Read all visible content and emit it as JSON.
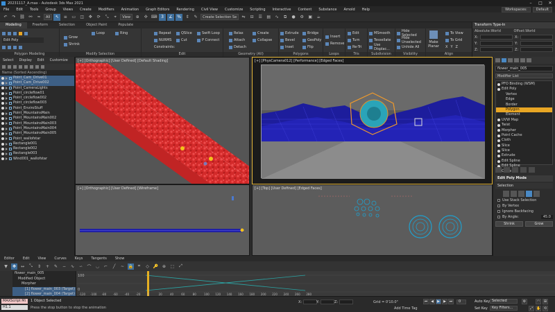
{
  "app": {
    "title": "20231117_A.max - Autodesk 3ds Max 2021"
  },
  "menu": [
    "File",
    "Edit",
    "Tools",
    "Group",
    "Views",
    "Create",
    "Modifiers",
    "Animation",
    "Graph Editors",
    "Rendering",
    "Civil View",
    "Customize",
    "Scripting",
    "Interactive",
    "Content",
    "Substance",
    "Arnold",
    "Help"
  ],
  "workspace": {
    "label": "Workspaces:",
    "value": "Default"
  },
  "toolbar": {
    "filter": "All",
    "view": "View",
    "selection_set": "Create Selection Se",
    "named_set_arrow": "▾"
  },
  "ribbon": {
    "tabs": [
      "Modeling",
      "Freeform",
      "Selection",
      "Object Paint",
      "Populate"
    ],
    "active_tab": "Modeling",
    "edit_poly_label": "Edit Poly",
    "groups": [
      {
        "name": "Polygon Modeling",
        "buttons": []
      },
      {
        "name": "Modify Selection",
        "buttons": [
          "Grow",
          "Shrink",
          "Loop",
          "Ring"
        ]
      },
      {
        "name": "Edit",
        "buttons": [
          "Repeat",
          "QSlice",
          "Swift Loop",
          "NURMS",
          "Cut",
          "P Connect",
          "Constraints:"
        ]
      },
      {
        "name": "Geometry (All)",
        "buttons": [
          "Relax",
          "Create",
          "Attach",
          "Collapse",
          "Detach"
        ]
      },
      {
        "name": "Polygons",
        "buttons": [
          "Extrude",
          "Bridge",
          "Bevel",
          "GeoPoly",
          "Inset",
          "Flip"
        ]
      },
      {
        "name": "Loops",
        "buttons": [
          "Insert",
          "Remove"
        ]
      },
      {
        "name": "Tris",
        "buttons": [
          "Edit",
          "Turn",
          "Re-Tri"
        ]
      },
      {
        "name": "Subdivision",
        "buttons": [
          "MSmooth",
          "Tessellate",
          "Use Displac..."
        ]
      },
      {
        "name": "Visibility",
        "buttons": [
          "Hide Selected",
          "Hide Unselected",
          "Unhide All"
        ]
      },
      {
        "name": "Align",
        "buttons": [
          "Make Planar",
          "To View",
          "To Grid",
          "X",
          "Y",
          "Z"
        ]
      }
    ]
  },
  "type_in": {
    "title": "Transform Type-In",
    "col1": "Absolute:World",
    "col2": "Offset:World",
    "axes": [
      "X:",
      "Y:",
      "Z:"
    ]
  },
  "scene_explorer": {
    "menu": [
      "Select",
      "Display",
      "Edit",
      "Customize"
    ],
    "header": "Name (Sorted Ascending)",
    "rows": [
      {
        "label": "Point_Cam_Drive01",
        "sel": true
      },
      {
        "label": "Point_Cam_Drive002",
        "sel": true
      },
      {
        "label": "Point_CameraLights",
        "sel": false
      },
      {
        "label": "Point_circleflow01",
        "sel": false
      },
      {
        "label": "Point_circleflow002",
        "sel": false
      },
      {
        "label": "Point_circleflow003",
        "sel": false
      },
      {
        "label": "Point_EnviroStuff",
        "sel": false
      },
      {
        "label": "Point_MountainsMain",
        "sel": false
      },
      {
        "label": "Point_MountainsMain002",
        "sel": false
      },
      {
        "label": "Point_MountainsMain003",
        "sel": false
      },
      {
        "label": "Point_MountainsMain004",
        "sel": false
      },
      {
        "label": "Point_MountainsMain005",
        "sel": false
      },
      {
        "label": "Point_wallofstar",
        "sel": false
      },
      {
        "label": "Rectangle001",
        "sel": false
      },
      {
        "label": "Rectangle002",
        "sel": false
      },
      {
        "label": "Rectangle003",
        "sel": false
      },
      {
        "label": "Wind001_wallofstar",
        "sel": false
      }
    ]
  },
  "viewports": {
    "top_left": "[+] [Orthographic] [User Defined] [Default Shading]",
    "top_right": "[+] [PhysCamera012] [Performance] [Edged Faces]",
    "bottom_left": "[+] [Orthographic] [User Defined] [Wireframe]",
    "bottom_right": "[+] [Top] [User Defined] [Edged Faces]"
  },
  "command_panel": {
    "object_name": "flower_main_005",
    "modifier_list": "Modifier List",
    "stack": [
      {
        "label": "PFO Binding (WSM)",
        "level": 0,
        "sel": false
      },
      {
        "label": "Edit Poly",
        "level": 0,
        "sel": false
      },
      {
        "label": "Vertex",
        "level": 1,
        "sel": false
      },
      {
        "label": "Edge",
        "level": 1,
        "sel": false
      },
      {
        "label": "Border",
        "level": 1,
        "sel": false
      },
      {
        "label": "Polygon",
        "level": 1,
        "sel": true
      },
      {
        "label": "Element",
        "level": 1,
        "sel": false
      },
      {
        "label": "UVW Map",
        "level": 0,
        "sel": false
      },
      {
        "label": "Twist",
        "level": 0,
        "sel": false
      },
      {
        "label": "Morpher",
        "level": 0,
        "sel": false
      },
      {
        "label": "Point Cache",
        "level": 0,
        "sel": false
      },
      {
        "label": "Cloth",
        "level": 0,
        "sel": false
      },
      {
        "label": "Slice",
        "level": 0,
        "sel": false
      },
      {
        "label": "Slice",
        "level": 0,
        "sel": false
      },
      {
        "label": "Extrude",
        "level": 0,
        "sel": false
      },
      {
        "label": "Edit Spline",
        "level": 0,
        "sel": false
      },
      {
        "label": "Edit Spline",
        "level": 0,
        "sel": false
      },
      {
        "label": "Circle",
        "level": 0,
        "sel": false
      }
    ],
    "rollout_mode": "Edit Poly Mode",
    "rollout_selection": "Selection",
    "checks": [
      "Use Stack Selection",
      "By Vertex",
      "Ignore Backfacing",
      "By Angle:"
    ],
    "by_angle_value": "45.0",
    "shrink": "Shrink",
    "grow": "Grow"
  },
  "track_view": {
    "menu": [
      "Editor",
      "Edit",
      "View",
      "Curves",
      "Keys",
      "Tangents",
      "Show"
    ],
    "tree": [
      "flower_main_005",
      "Modified Object",
      "Morpher",
      "[1] flower_main_003 (Target)",
      "[2] flower_main_004 (Target)"
    ],
    "y_ticks": [
      "100",
      "0"
    ],
    "x_ticks": [
      "-120",
      "-100",
      "-80",
      "-60",
      "-40",
      "-20",
      "0",
      "20",
      "40",
      "60",
      "80",
      "100",
      "120",
      "140",
      "160",
      "180",
      "200",
      "220",
      "240",
      "260",
      "280"
    ]
  },
  "status": {
    "maxscript": "MAXScript Mi",
    "maxscript2": "H1.1",
    "selected": "1 Object Selected",
    "prompt": "Press the stop button to stop the animation",
    "x_label": "X:",
    "y_label": "Y:",
    "z_label": "Z:",
    "grid": "Grid = 0'10.0\"",
    "add_time_tag": "Add Time Tag",
    "auto_key": "Auto Key",
    "set_key": "Set Key",
    "selected_drop": "Selected",
    "key_filters": "Key Filters...",
    "frame": "0"
  }
}
